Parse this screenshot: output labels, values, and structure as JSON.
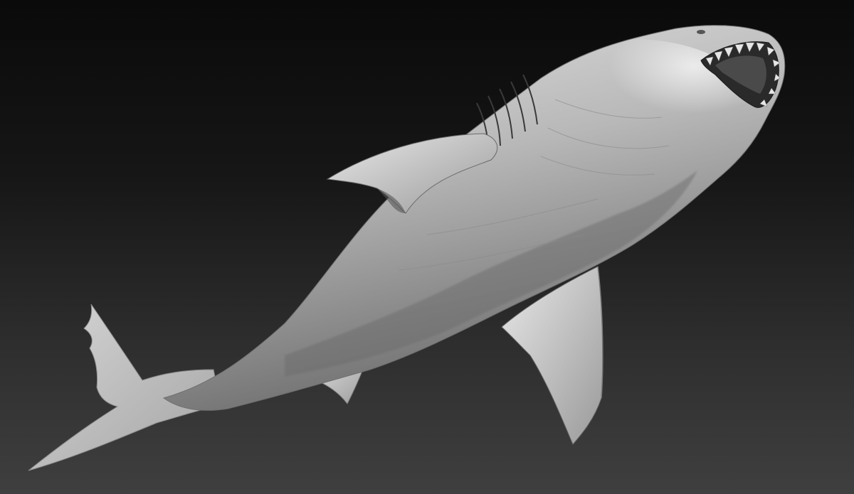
{
  "scene": {
    "subject": "shark-sculpt",
    "background_top": "#0a0a0a",
    "background_bottom": "#3f3f3f",
    "clay_light": "#dcdcdc",
    "clay_mid": "#a9a9a9",
    "clay_dark": "#5a5a5a",
    "mouth_interior": "#2a2a2a"
  }
}
